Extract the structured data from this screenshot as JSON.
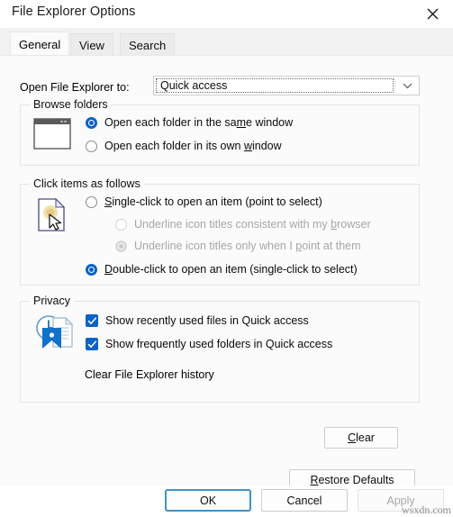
{
  "window": {
    "title": "File Explorer Options",
    "close_icon": "close-icon"
  },
  "tabs": [
    {
      "label": "General",
      "active": true
    },
    {
      "label": "View",
      "active": false
    },
    {
      "label": "Search",
      "active": false
    }
  ],
  "general": {
    "open_to": {
      "label": "Open File Explorer to:",
      "value": "Quick access",
      "dropdown_icon": "chevron-down-icon"
    },
    "browse_folders": {
      "title": "Browse folders",
      "icon": "window-icon",
      "options": [
        {
          "label_pre": "Open each folder in the sa",
          "accel": "m",
          "label_post": "e window",
          "checked": true
        },
        {
          "label_pre": "Open each folder in its own ",
          "accel": "w",
          "label_post": "indow",
          "checked": false
        }
      ]
    },
    "click_items": {
      "title": "Click items as follows",
      "icon": "pointer-document-icon",
      "options": [
        {
          "label_pre": "",
          "accel": "S",
          "label_post": "ingle-click to open an item (point to select)",
          "checked": false,
          "disabled": false,
          "indent": false
        },
        {
          "label_pre": "Underline icon titles consistent with my ",
          "accel": "b",
          "label_post": "rowser",
          "checked": false,
          "disabled": true,
          "indent": true
        },
        {
          "label_pre": "Underline icon titles only when I ",
          "accel": "p",
          "label_post": "oint at them",
          "checked": true,
          "disabled": true,
          "indent": true
        },
        {
          "label_pre": "",
          "accel": "D",
          "label_post": "ouble-click to open an item (single-click to select)",
          "checked": true,
          "disabled": false,
          "indent": false
        }
      ]
    },
    "privacy": {
      "title": "Privacy",
      "icon": "history-document-icon",
      "checkboxes": [
        {
          "label": "Show recently used files in Quick access",
          "checked": true
        },
        {
          "label": "Show frequently used folders in Quick access",
          "checked": true
        }
      ],
      "clear_history_label": "Clear File Explorer history",
      "clear_button": {
        "accel": "C",
        "label_post": "lear"
      }
    },
    "restore_button": {
      "accel": "R",
      "label_post": "estore Defaults"
    }
  },
  "footer": {
    "ok": "OK",
    "cancel": "Cancel",
    "apply": "Apply"
  },
  "watermark": "wsxdn.com",
  "colors": {
    "accent": "#0a62c7",
    "focus_ring": "#3e93c6",
    "dialog_bg": "#fbfbfb",
    "titlebar_bg": "#ffffff",
    "disabled_text": "#a8a8a8"
  }
}
